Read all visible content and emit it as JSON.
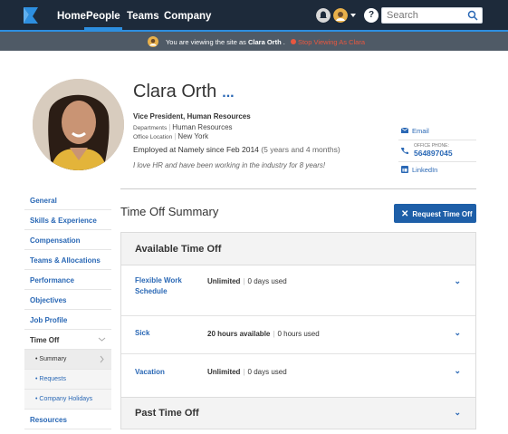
{
  "nav": {
    "items": [
      {
        "label": "Home",
        "active": false
      },
      {
        "label": "People",
        "active": true
      },
      {
        "label": "Teams",
        "active": false
      },
      {
        "label": "Company",
        "active": false
      }
    ],
    "search_placeholder": "Search",
    "help_label": "?"
  },
  "banner": {
    "prefix": "You are viewing the site as ",
    "name": "Clara Orth",
    "suffix": " .",
    "stop_label": "Stop Viewing As Clara"
  },
  "profile": {
    "name": "Clara Orth",
    "more_label": "...",
    "title": "Vice President, Human Resources",
    "departments_label": "Departments",
    "departments_value": "Human Resources",
    "office_label": "Office Location",
    "office_value": "New York",
    "employed": "Employed at Namely since Feb 2014",
    "tenure": "(5 years and 4 months)",
    "quote": "I love HR and have been working in the industry for 8 years!"
  },
  "contact": {
    "email_label": "Email",
    "phone_label": "OFFICE PHONE:",
    "phone_value": "564897045",
    "linkedin_label": "LinkedIn"
  },
  "sidebar": {
    "items": [
      {
        "label": "General"
      },
      {
        "label": "Skills & Experience"
      },
      {
        "label": "Compensation"
      },
      {
        "label": "Teams & Allocations"
      },
      {
        "label": "Performance"
      },
      {
        "label": "Objectives"
      },
      {
        "label": "Job Profile"
      },
      {
        "label": "Time Off"
      }
    ],
    "subitems": [
      {
        "label": "• Summary"
      },
      {
        "label": "• Requests"
      },
      {
        "label": "• Company Holidays"
      }
    ],
    "bottom": {
      "label": "Resources"
    }
  },
  "timeoff": {
    "title": "Time Off Summary",
    "request_label": "Request Time Off",
    "available_header": "Available Time Off",
    "rows": [
      {
        "name": "Flexible Work Schedule",
        "primary": "Unlimited",
        "secondary": "0 days used"
      },
      {
        "name": "Sick",
        "primary": "20 hours available",
        "secondary": "0 hours used"
      },
      {
        "name": "Vacation",
        "primary": "Unlimited",
        "secondary": "0 days used"
      }
    ],
    "past_header": "Past Time Off"
  },
  "colors": {
    "topbar": "#1d2a3a",
    "accent": "#2d8fe0",
    "link": "#2a68b5",
    "button": "#1e5fa8",
    "stop": "#e9573f"
  }
}
